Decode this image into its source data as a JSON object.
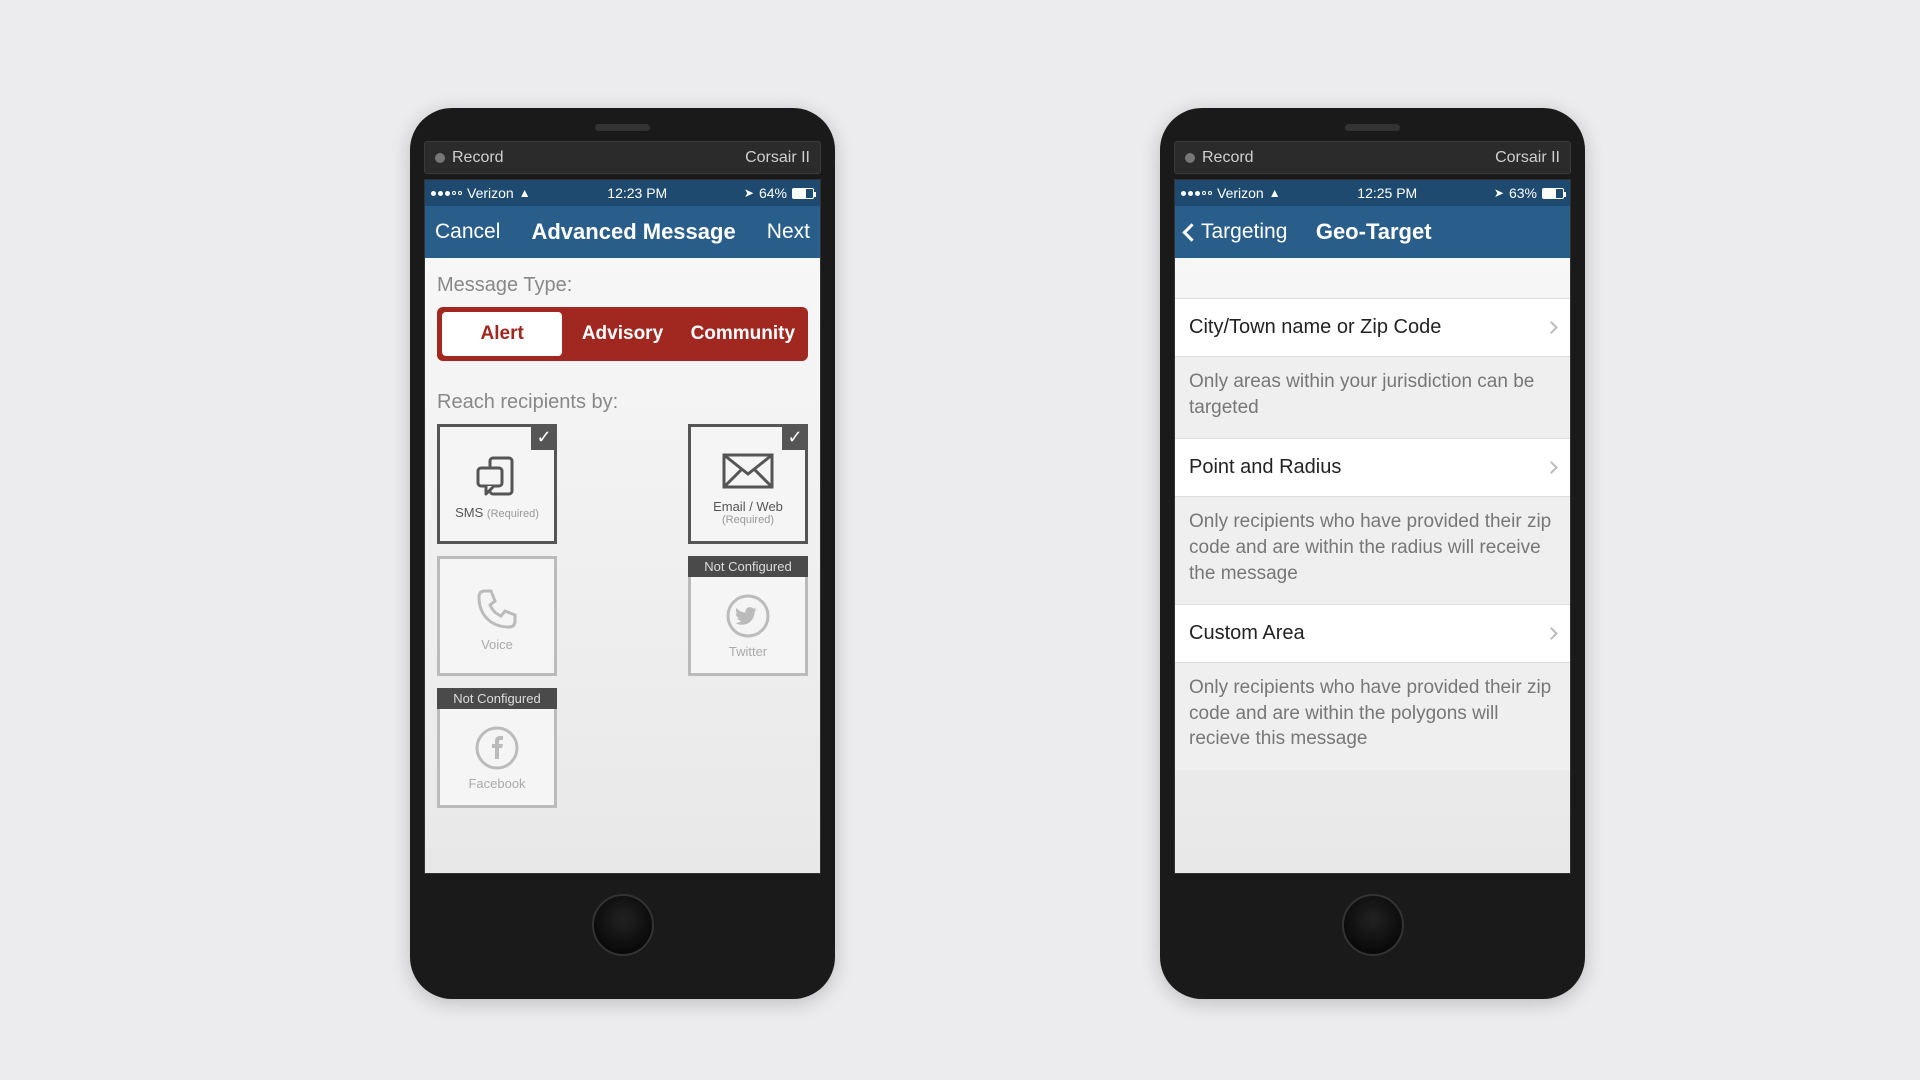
{
  "phone_left": {
    "sim": {
      "record": "Record",
      "device": "Corsair II"
    },
    "status": {
      "carrier": "Verizon",
      "time": "12:23 PM",
      "battery": "64%"
    },
    "nav": {
      "left": "Cancel",
      "title": "Advanced Message",
      "right": "Next"
    },
    "section1": "Message Type:",
    "tabs": {
      "alert": "Alert",
      "advisory": "Advisory",
      "community": "Community"
    },
    "section2": "Reach recipients by:",
    "channels": {
      "sms": {
        "label": "SMS",
        "sub": "(Required)"
      },
      "email": {
        "label": "Email / Web",
        "sub": "(Required)"
      },
      "voice": {
        "label": "Voice"
      },
      "twitter": {
        "label": "Twitter",
        "badge": "Not Configured"
      },
      "facebook": {
        "label": "Facebook",
        "badge": "Not Configured"
      }
    }
  },
  "phone_right": {
    "sim": {
      "record": "Record",
      "device": "Corsair II"
    },
    "status": {
      "carrier": "Verizon",
      "time": "12:25 PM",
      "battery": "63%"
    },
    "nav": {
      "back": "Targeting",
      "title": "Geo-Target"
    },
    "rows": {
      "city": {
        "title": "City/Town name or Zip Code",
        "desc": "Only areas within your jurisdiction can be targeted"
      },
      "radius": {
        "title": "Point and Radius",
        "desc": "Only recipients who have provided their zip code and are within the radius will receive the message"
      },
      "custom": {
        "title": "Custom Area",
        "desc": "Only recipients who have provided their zip code and are within the polygons will recieve this message"
      }
    }
  }
}
